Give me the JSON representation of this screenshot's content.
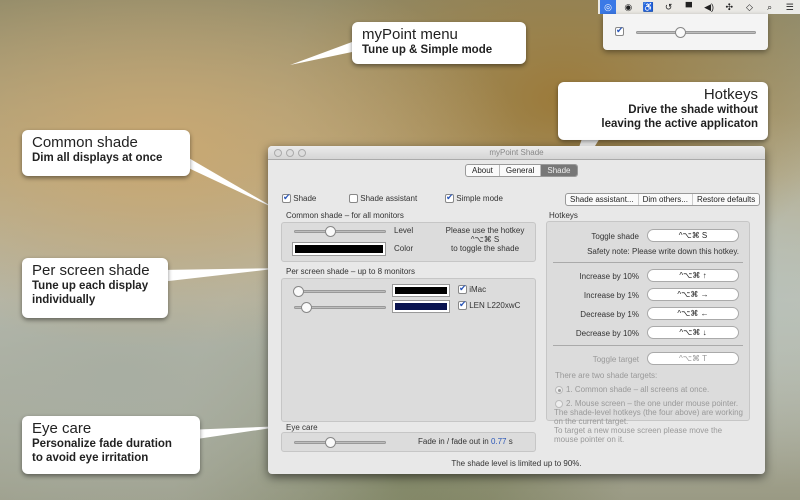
{
  "menubar": {
    "icons": [
      "mypoint-icon",
      "target-icon",
      "accessibility-icon",
      "time-machine-icon",
      "display-icon",
      "volume-icon",
      "bluetooth-icon",
      "wifi-icon",
      "search-icon",
      "list-icon"
    ]
  },
  "menu": {
    "checked": true,
    "slider_value": 0.35
  },
  "callouts": {
    "mypoint": {
      "title": "myPoint menu",
      "subtitle": "Tune up & Simple mode"
    },
    "hotkeys": {
      "title": "Hotkeys",
      "line1": "Drive the shade without",
      "line2": "leaving the active applicaton"
    },
    "common": {
      "title": "Common shade",
      "subtitle": "Dim all displays at once"
    },
    "perscreen": {
      "title": "Per screen shade",
      "line1": "Tune up each display",
      "line2": "individually"
    },
    "eyecare": {
      "title": "Eye care",
      "line1": "Personalize fade duration",
      "line2": "to avoid eye irritation"
    }
  },
  "window": {
    "title": "myPoint Shade",
    "tabs": [
      "About",
      "General",
      "Shade"
    ],
    "selected_tab": "Shade",
    "checks": {
      "shade": "Shade",
      "assistant": "Shade assistant",
      "simple": "Simple mode"
    },
    "buttons": [
      "Shade assistant...",
      "Dim others...",
      "Restore defaults"
    ],
    "common": {
      "header": "Common shade – for all monitors",
      "level": "Level",
      "color": "Color",
      "level_value": 0.35,
      "color_value": "#000000",
      "hint1": "Please use the hotkey",
      "hint2": "^⌥⌘ S",
      "hint3": "to toggle the shade"
    },
    "perscreen": {
      "header": "Per screen shade – up to 8 monitors",
      "monitors": [
        {
          "name": "iMac",
          "level": 0.0,
          "color": "#000000",
          "checked": true
        },
        {
          "name": "LEN L220xwC",
          "level": 0.08,
          "color": "#0a1450",
          "checked": true
        }
      ]
    },
    "eyecare": {
      "header": "Eye care",
      "text_pre": "Fade in / fade out in ",
      "value": "0.77",
      "unit": " s",
      "slider_value": 0.35
    },
    "footer": "The shade level is limited up to 90%.",
    "hotkeys": {
      "header": "Hotkeys",
      "toggle_label": "Toggle shade",
      "toggle_key": "^⌥⌘ S",
      "safety": "Safety note: Please write down this hotkey.",
      "items": [
        {
          "label": "Increase by 10%",
          "key": "^⌥⌘ ↑"
        },
        {
          "label": "Increase by 1%",
          "key": "^⌥⌘ →"
        },
        {
          "label": "Decrease by 1%",
          "key": "^⌥⌘ ←"
        },
        {
          "label": "Decrease by 10%",
          "key": "^⌥⌘ ↓"
        }
      ],
      "target_label": "Toggle target",
      "target_key": "^⌥⌘ T",
      "targets_intro": "There are two shade targets:",
      "target1": "1. Common shade – all screens at once.",
      "target2": "2. Mouse screen – the one under mouse pointer.",
      "note1": "The shade-level hotkeys (the four above) are working on the current target.",
      "note2": "To target a new mouse screen please move the mouse pointer on it."
    }
  }
}
